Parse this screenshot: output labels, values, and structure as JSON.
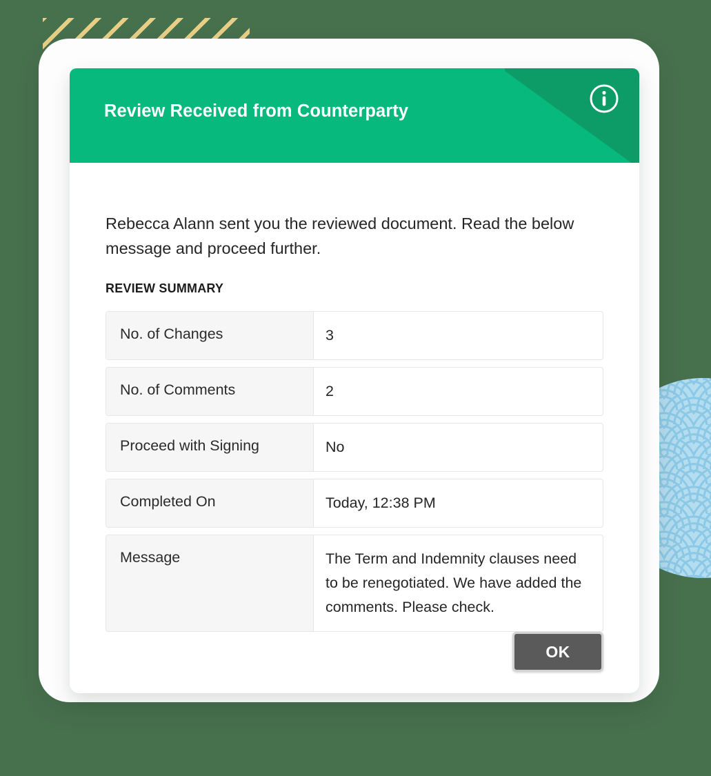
{
  "dialog": {
    "title": "Review Received from Counterparty",
    "info_icon": "info-circle-icon",
    "intro_text": "Rebecca Alann sent you the reviewed document. Read the below message and proceed further.",
    "summary_heading": "REVIEW SUMMARY",
    "summary_rows": [
      {
        "label": "No. of Changes",
        "value": "3"
      },
      {
        "label": "No. of Comments",
        "value": "2"
      },
      {
        "label": "Proceed with Signing",
        "value": "No"
      },
      {
        "label": "Completed On",
        "value": "Today, 12:38 PM"
      },
      {
        "label": "Message",
        "value": "The Term and Indemnity clauses need to be renegotiated. We have added the comments. Please check."
      }
    ],
    "ok_label": "OK"
  },
  "colors": {
    "header_green": "#07b97c",
    "header_wedge_green": "#0d9b68",
    "page_background": "#47704d",
    "hatch_gold": "#e8cf86",
    "circle_blue": "#b5ddf0",
    "circle_blue_dark": "#8cc9e6",
    "row_label_background": "#f6f6f6",
    "row_border": "#e6e6e6",
    "ok_button_background": "#5a5a5a",
    "ok_button_border": "#d3d3d3",
    "text_primary": "#262626"
  }
}
